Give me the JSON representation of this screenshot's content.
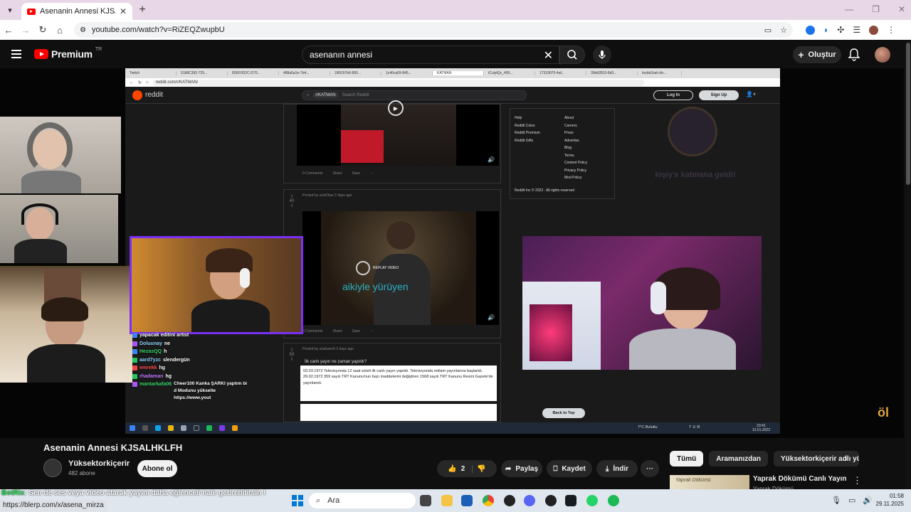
{
  "browser": {
    "active_tab_title": "Asenanin Annesi KJSALHKLFH",
    "url": "youtube.com/watch?v=RiZEQZwupbU"
  },
  "youtube_header": {
    "logo_text": "Premium",
    "region": "TR",
    "search_query": "asenanın annesi",
    "create_label": "Oluştur"
  },
  "inner_browser": {
    "tabs": [
      "Twitch",
      "5188C392-725...",
      "82EF0D2C-D70...",
      "488a5a1e-7b4...",
      "1B9197b6-895...",
      "1c46ca59-845...",
      "KATMAN",
      "tCulytQc_400...",
      "17319070-4af...",
      "39dd2810-8d3...",
      "bcddc5ad-cfe..."
    ],
    "url": "reddit.com/r/KATMAN/",
    "reddit_word": "reddit",
    "subreddit": "r/KATMAN",
    "search_placeholder": "Search Reddit",
    "login": "Log In",
    "signup": "Sign Up",
    "post1_comments": "0 Comments",
    "share": "Share",
    "save": "Save",
    "post2_meta": "Posted by u/ekOtas 2 days ago",
    "post2_votes": "40",
    "post2_replay": "REPLAY VIDEO",
    "post2_overlay": "aikiyle yürüyen",
    "post3_meta": "Posted by u/arkann0 2 days ago",
    "post3_votes": "59",
    "quote_question": "İlk canlı yayın ne zaman yapıldı?",
    "quote_text": "03.03.1972 Televizyonda 12 saat süreli ilk canlı yayın yapıldı. Televizyonda reklam yayınlarına başlandı. 29.02.1972 359 sayılı TRT Kanunu'nun bazı maddelerini değiştiren 1568 sayılı TRT Kanunu Resmi Gazete'de yayınlandı.",
    "sidebar_col1": [
      "Help",
      "Reddit Coins",
      "Reddit Premium",
      "Reddit Gifts"
    ],
    "sidebar_col2": [
      "About",
      "Careers",
      "Press",
      "Advertise",
      "Blog",
      "Terms",
      "Content Policy",
      "Privacy Policy",
      "Mod Policy"
    ],
    "sidebar_footer": "Reddit Inc © 2022 . All rights reserved",
    "back_to_top": "Back to Top",
    "alert_text": "kişiy'e katmana geldi!",
    "weather": "7°C Bulutlu",
    "lang": "TUR",
    "clock_time": "23:41",
    "clock_date": "12.01.2022"
  },
  "chat": [
    {
      "user": "",
      "msg": "yapacak editini artist",
      "badge": "#3b82f6"
    },
    {
      "user": "Doluunay",
      "msg": "ne",
      "badge": "#a855f7"
    },
    {
      "user": "HezasQQ",
      "msg": "h",
      "badge": "#3b82f6"
    },
    {
      "user": "aard7yzc",
      "msg": "slendergün",
      "badge": "#22c55e"
    },
    {
      "user": "emrekk",
      "msg": "hg",
      "badge": "#ef4444"
    },
    {
      "user": "rhadaman",
      "msg": "hg",
      "badge": "#22c55e"
    },
    {
      "user": "mantarkafa06",
      "msg": "Cheer100 Kanka ŞARKI yaptım bi d Modunu yükselte https://www.yout",
      "badge": "#a855f7"
    }
  ],
  "video": {
    "title": "Asenanin Annesi KJSALHKLFH",
    "channel": "Yüksektorkiçerir",
    "subscribers": "482 abone",
    "subscribe_label": "Abone ol",
    "like_count": "2",
    "share_label": "Paylaş",
    "save_label": "Kaydet",
    "download_label": "İndir"
  },
  "chips": [
    "Tümü",
    "Aramanızdan",
    "Yüksektorkiçerir adlı yü..."
  ],
  "recommendation": {
    "thumb_text": "Yaprak Dökümü",
    "title": "Yaprak Dökümü Canlı Yayın",
    "channel": "Yaprak Dökümü"
  },
  "overlay_bot": {
    "name": "BotRix",
    "message": ": Sen de ses veya video atarak yayını daha eğlenceli hale getirebilirsin !"
  },
  "status_link": "https://blerp.com/x/asena_mirza",
  "taskbar": {
    "search_label": "Ara",
    "time": "01:58",
    "date": "29.11.2025"
  }
}
